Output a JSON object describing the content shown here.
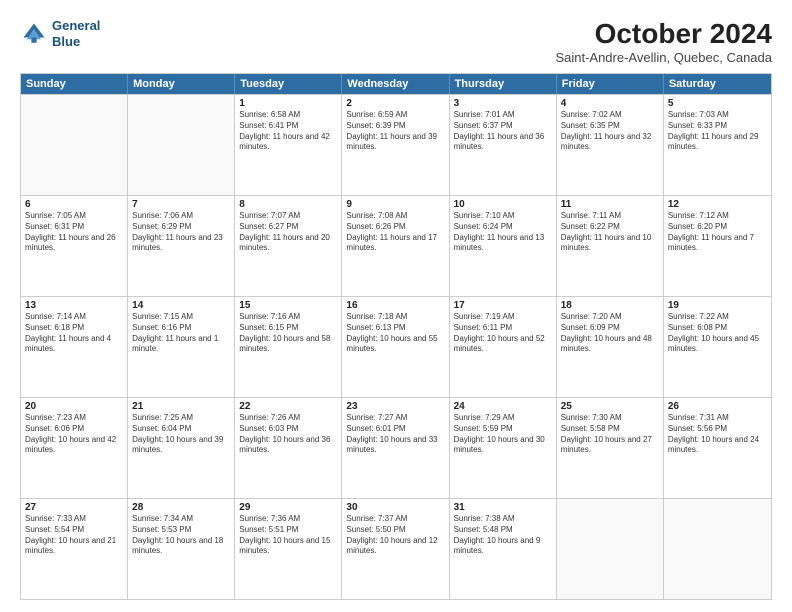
{
  "header": {
    "logo_line1": "General",
    "logo_line2": "Blue",
    "month": "October 2024",
    "location": "Saint-Andre-Avellin, Quebec, Canada"
  },
  "weekdays": [
    "Sunday",
    "Monday",
    "Tuesday",
    "Wednesday",
    "Thursday",
    "Friday",
    "Saturday"
  ],
  "rows": [
    [
      {
        "day": "",
        "info": "",
        "empty": true
      },
      {
        "day": "",
        "info": "",
        "empty": true
      },
      {
        "day": "1",
        "info": "Sunrise: 6:58 AM\nSunset: 6:41 PM\nDaylight: 11 hours and 42 minutes."
      },
      {
        "day": "2",
        "info": "Sunrise: 6:59 AM\nSunset: 6:39 PM\nDaylight: 11 hours and 39 minutes."
      },
      {
        "day": "3",
        "info": "Sunrise: 7:01 AM\nSunset: 6:37 PM\nDaylight: 11 hours and 36 minutes."
      },
      {
        "day": "4",
        "info": "Sunrise: 7:02 AM\nSunset: 6:35 PM\nDaylight: 11 hours and 32 minutes."
      },
      {
        "day": "5",
        "info": "Sunrise: 7:03 AM\nSunset: 6:33 PM\nDaylight: 11 hours and 29 minutes."
      }
    ],
    [
      {
        "day": "6",
        "info": "Sunrise: 7:05 AM\nSunset: 6:31 PM\nDaylight: 11 hours and 26 minutes."
      },
      {
        "day": "7",
        "info": "Sunrise: 7:06 AM\nSunset: 6:29 PM\nDaylight: 11 hours and 23 minutes."
      },
      {
        "day": "8",
        "info": "Sunrise: 7:07 AM\nSunset: 6:27 PM\nDaylight: 11 hours and 20 minutes."
      },
      {
        "day": "9",
        "info": "Sunrise: 7:08 AM\nSunset: 6:26 PM\nDaylight: 11 hours and 17 minutes."
      },
      {
        "day": "10",
        "info": "Sunrise: 7:10 AM\nSunset: 6:24 PM\nDaylight: 11 hours and 13 minutes."
      },
      {
        "day": "11",
        "info": "Sunrise: 7:11 AM\nSunset: 6:22 PM\nDaylight: 11 hours and 10 minutes."
      },
      {
        "day": "12",
        "info": "Sunrise: 7:12 AM\nSunset: 6:20 PM\nDaylight: 11 hours and 7 minutes."
      }
    ],
    [
      {
        "day": "13",
        "info": "Sunrise: 7:14 AM\nSunset: 6:18 PM\nDaylight: 11 hours and 4 minutes."
      },
      {
        "day": "14",
        "info": "Sunrise: 7:15 AM\nSunset: 6:16 PM\nDaylight: 11 hours and 1 minute."
      },
      {
        "day": "15",
        "info": "Sunrise: 7:16 AM\nSunset: 6:15 PM\nDaylight: 10 hours and 58 minutes."
      },
      {
        "day": "16",
        "info": "Sunrise: 7:18 AM\nSunset: 6:13 PM\nDaylight: 10 hours and 55 minutes."
      },
      {
        "day": "17",
        "info": "Sunrise: 7:19 AM\nSunset: 6:11 PM\nDaylight: 10 hours and 52 minutes."
      },
      {
        "day": "18",
        "info": "Sunrise: 7:20 AM\nSunset: 6:09 PM\nDaylight: 10 hours and 48 minutes."
      },
      {
        "day": "19",
        "info": "Sunrise: 7:22 AM\nSunset: 6:08 PM\nDaylight: 10 hours and 45 minutes."
      }
    ],
    [
      {
        "day": "20",
        "info": "Sunrise: 7:23 AM\nSunset: 6:06 PM\nDaylight: 10 hours and 42 minutes."
      },
      {
        "day": "21",
        "info": "Sunrise: 7:25 AM\nSunset: 6:04 PM\nDaylight: 10 hours and 39 minutes."
      },
      {
        "day": "22",
        "info": "Sunrise: 7:26 AM\nSunset: 6:03 PM\nDaylight: 10 hours and 36 minutes."
      },
      {
        "day": "23",
        "info": "Sunrise: 7:27 AM\nSunset: 6:01 PM\nDaylight: 10 hours and 33 minutes."
      },
      {
        "day": "24",
        "info": "Sunrise: 7:29 AM\nSunset: 5:59 PM\nDaylight: 10 hours and 30 minutes."
      },
      {
        "day": "25",
        "info": "Sunrise: 7:30 AM\nSunset: 5:58 PM\nDaylight: 10 hours and 27 minutes."
      },
      {
        "day": "26",
        "info": "Sunrise: 7:31 AM\nSunset: 5:56 PM\nDaylight: 10 hours and 24 minutes."
      }
    ],
    [
      {
        "day": "27",
        "info": "Sunrise: 7:33 AM\nSunset: 5:54 PM\nDaylight: 10 hours and 21 minutes."
      },
      {
        "day": "28",
        "info": "Sunrise: 7:34 AM\nSunset: 5:53 PM\nDaylight: 10 hours and 18 minutes."
      },
      {
        "day": "29",
        "info": "Sunrise: 7:36 AM\nSunset: 5:51 PM\nDaylight: 10 hours and 15 minutes."
      },
      {
        "day": "30",
        "info": "Sunrise: 7:37 AM\nSunset: 5:50 PM\nDaylight: 10 hours and 12 minutes."
      },
      {
        "day": "31",
        "info": "Sunrise: 7:38 AM\nSunset: 5:48 PM\nDaylight: 10 hours and 9 minutes."
      },
      {
        "day": "",
        "info": "",
        "empty": true
      },
      {
        "day": "",
        "info": "",
        "empty": true
      }
    ]
  ]
}
